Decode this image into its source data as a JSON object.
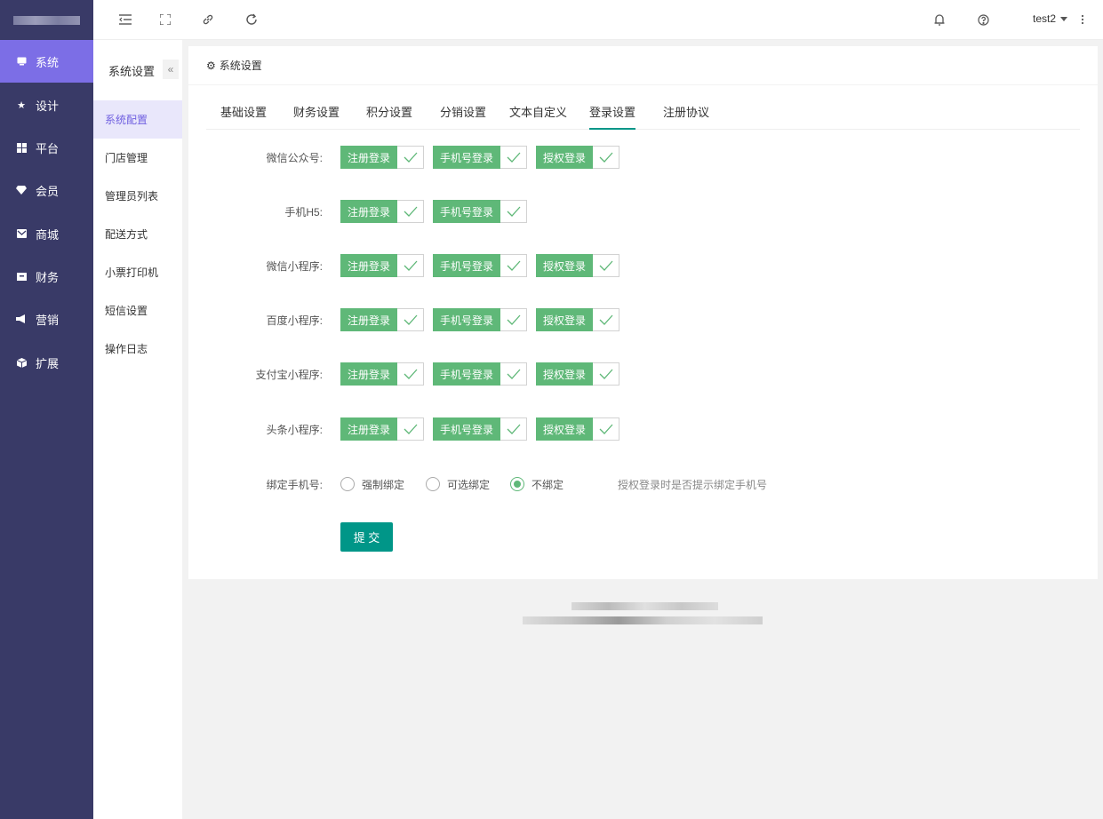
{
  "sidebar": {
    "items": [
      {
        "label": "系统",
        "icon": "monitor-icon"
      },
      {
        "label": "设计",
        "icon": "star-icon"
      },
      {
        "label": "平台",
        "icon": "grid-icon"
      },
      {
        "label": "会员",
        "icon": "gem-icon"
      },
      {
        "label": "商城",
        "icon": "mail-icon"
      },
      {
        "label": "财务",
        "icon": "wallet-icon"
      },
      {
        "label": "营销",
        "icon": "megaphone-icon"
      },
      {
        "label": "扩展",
        "icon": "cube-icon"
      }
    ]
  },
  "submenu": {
    "title": "系统设置",
    "fold_glyph": "«",
    "items": [
      "系统配置",
      "门店管理",
      "管理员列表",
      "配送方式",
      "小票打印机",
      "短信设置",
      "操作日志"
    ]
  },
  "topbar": {
    "user": "test2"
  },
  "card": {
    "title": "系统设置",
    "tabs": [
      "基础设置",
      "财务设置",
      "积分设置",
      "分销设置",
      "文本自定义",
      "登录设置",
      "注册协议"
    ]
  },
  "form": {
    "rows": [
      {
        "label": "微信公众号:",
        "options": [
          "注册登录",
          "手机号登录",
          "授权登录"
        ]
      },
      {
        "label": "手机H5:",
        "options": [
          "注册登录",
          "手机号登录"
        ]
      },
      {
        "label": "微信小程序:",
        "options": [
          "注册登录",
          "手机号登录",
          "授权登录"
        ]
      },
      {
        "label": "百度小程序:",
        "options": [
          "注册登录",
          "手机号登录",
          "授权登录"
        ]
      },
      {
        "label": "支付宝小程序:",
        "options": [
          "注册登录",
          "手机号登录",
          "授权登录"
        ]
      },
      {
        "label": "头条小程序:",
        "options": [
          "注册登录",
          "手机号登录",
          "授权登录"
        ]
      }
    ],
    "bind_phone": {
      "label": "绑定手机号:",
      "options": [
        "强制绑定",
        "可选绑定",
        "不绑定"
      ],
      "selected": "不绑定",
      "hint": "授权登录时是否提示绑定手机号"
    },
    "submit_label": "提 交"
  },
  "colors": {
    "sidebar_bg": "#393a67",
    "sidebar_active": "#7c6ee6",
    "checkbox_green": "#5fb878",
    "submit_teal": "#009688"
  }
}
